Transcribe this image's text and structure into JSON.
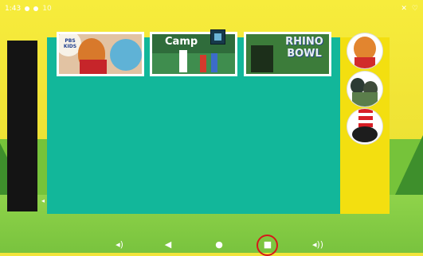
{
  "status_bar": {
    "time": "1:43",
    "extra": "10"
  },
  "tiles": [
    {
      "title": "PBS KIDS"
    },
    {
      "title": "Camp"
    },
    {
      "title": "RHINO BOWL"
    }
  ],
  "avatars": [
    "Daniel Tiger",
    "Wild Kratts",
    "Cat in the Hat"
  ],
  "nav": {
    "volume_down": "volume-down-icon",
    "back": "back-icon",
    "home": "home-icon",
    "recents": "recents-icon",
    "volume_up": "volume-up-icon"
  },
  "colors": {
    "sky": "#f1e436",
    "panel": "#12b79a",
    "grass": "#79c33e",
    "recents_ring": "#d6191b"
  }
}
